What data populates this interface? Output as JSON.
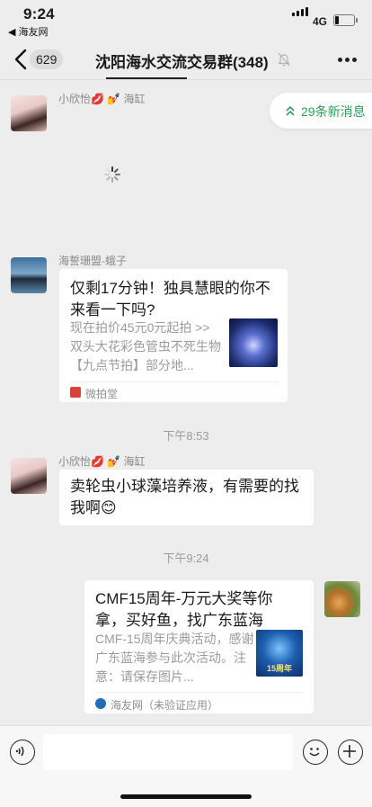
{
  "status_bar": {
    "time": "9:24",
    "back_app": "◀ 海友网",
    "network": "4G"
  },
  "nav": {
    "unread_count": "629",
    "title": "沈阳海水交流交易群(348)"
  },
  "new_messages": {
    "label": "29条新消息"
  },
  "messages": [
    {
      "type": "text-placeholder",
      "sender": "小欣怡💋 💅 海缸"
    },
    {
      "type": "card",
      "sender": "海誓珊盟-蛾子",
      "title": "仅剩17分钟！独具慧眼的你不来看一下吗?",
      "desc": "现在拍价45元0元起拍 >> 双头大花彩色管虫不死生物【九点节拍】部分地...",
      "source": "微拍堂"
    },
    {
      "type": "time",
      "text": "下午8:53"
    },
    {
      "type": "text",
      "sender": "小欣怡💋 💅 海缸",
      "text": "卖轮虫小球藻培养液，有需要的找我啊😊"
    },
    {
      "type": "time",
      "text": "下午9:24"
    },
    {
      "type": "card-self",
      "title": "CMF15周年-万元大奖等你拿，买好鱼，找广东蓝海",
      "desc": "CMF-15周年庆典活动，感谢广东蓝海参与此次活动。注意：请保存图片...",
      "thumb_text": "15周年",
      "source": "海友网（未验证应用）"
    }
  ],
  "colors": {
    "background": "#ededed",
    "bubble": "#ffffff",
    "accent_green": "#2f9a5a"
  }
}
